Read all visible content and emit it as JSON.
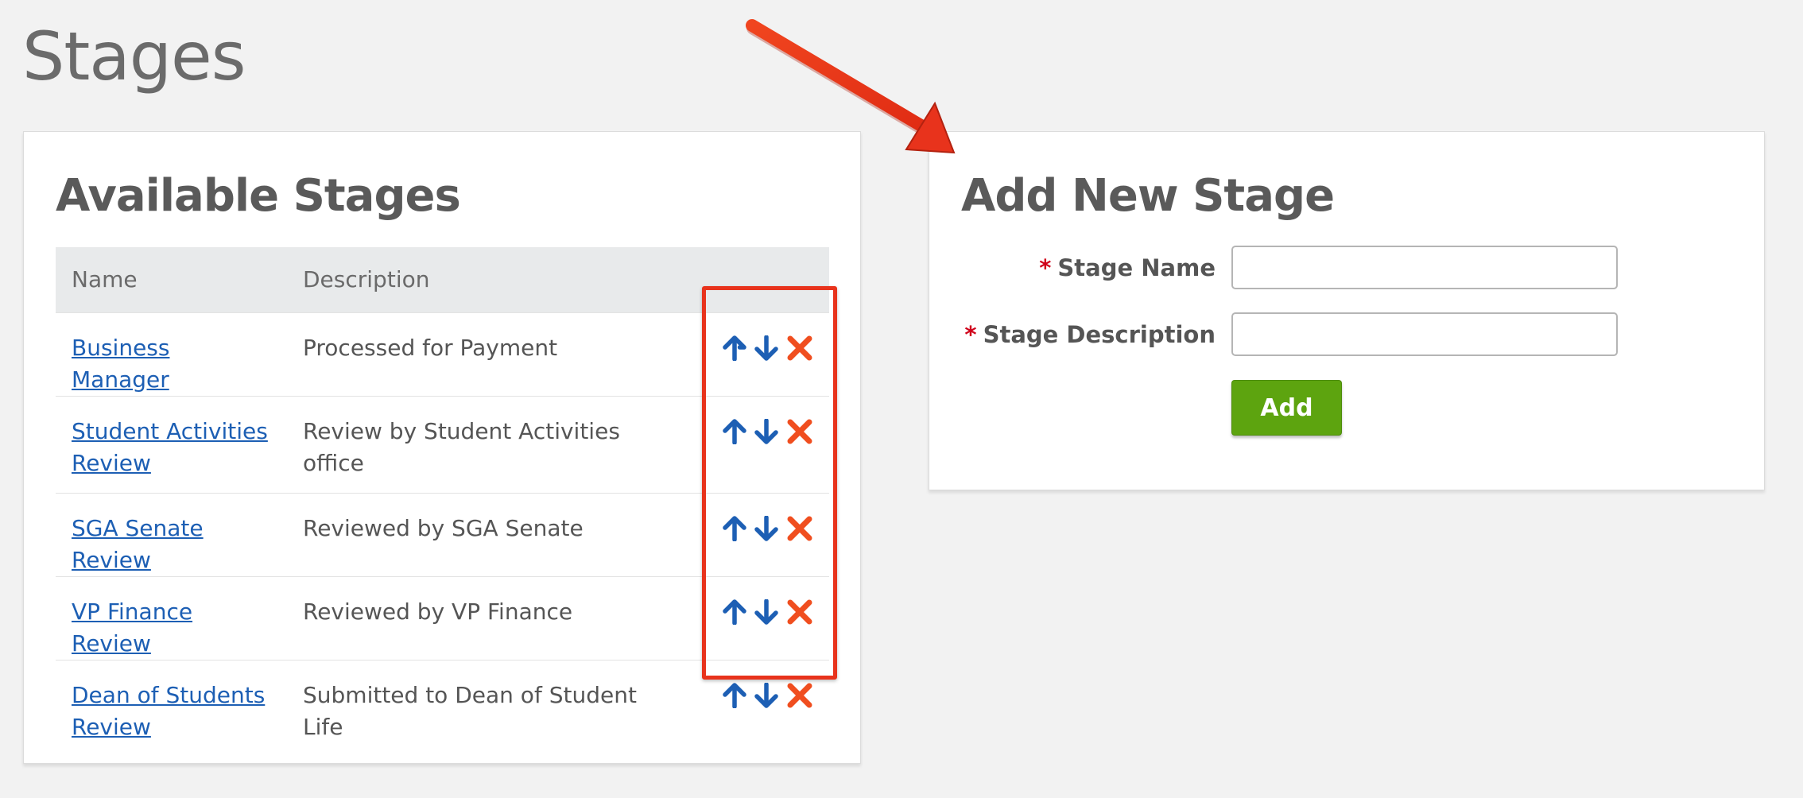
{
  "page": {
    "title": "Stages"
  },
  "available": {
    "heading": "Available Stages",
    "columns": {
      "name": "Name",
      "description": "Description"
    },
    "rows": [
      {
        "name": "Business Manager",
        "description": "Processed for Payment"
      },
      {
        "name": "Student Activities Review",
        "description": "Review by Student Activities office"
      },
      {
        "name": "SGA Senate Review",
        "description": "Reviewed by SGA Senate"
      },
      {
        "name": "VP Finance Review",
        "description": "Reviewed by VP Finance"
      },
      {
        "name": "Dean of Students Review",
        "description": "Submitted to Dean of Student Life"
      }
    ],
    "row_actions": [
      "arrow-up-icon",
      "arrow-down-icon",
      "delete-x-icon"
    ]
  },
  "add_form": {
    "heading": "Add New Stage",
    "required_marker": "*",
    "stage_name_label": "Stage Name",
    "stage_name_value": "",
    "stage_description_label": "Stage Description",
    "stage_description_value": "",
    "add_label": "Add"
  },
  "colors": {
    "link": "#1d5fb4",
    "arrow_icons": "#1d5fb4",
    "delete_icon": "#f04e1f",
    "add_button": "#5da40f",
    "annotation": "#e8331c",
    "required": "#d0021b"
  }
}
